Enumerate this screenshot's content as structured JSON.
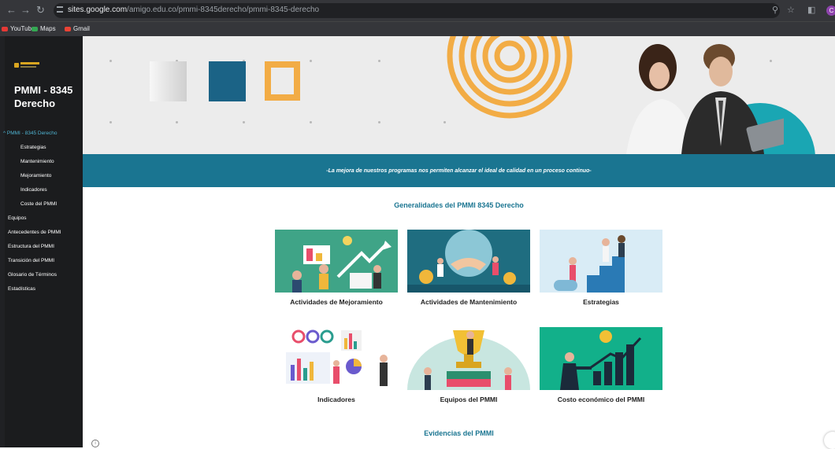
{
  "browser": {
    "url_host": "sites.google.com",
    "url_path": "/amigo.edu.co/pmmi-8345derecho/pmmi-8345-derecho",
    "bookmarks": [
      "YouTube",
      "Maps",
      "Gmail"
    ],
    "profile_initial": "C"
  },
  "sidebar": {
    "site_title": "PMMI - 8345 Derecho",
    "active_section": "PMMI - 8345 Derecho",
    "sub_items": [
      "Estrategias",
      "Mantenimiento",
      "Mejoramiento",
      "Indicadores",
      "Coste del PMMI"
    ],
    "top_items": [
      "Equipos",
      "Antecedentes de PMMI",
      "Estructura del PMMI",
      "Transición del PMMI",
      "Glosario de Términos",
      "Estadísticas"
    ]
  },
  "banner": {
    "tagline": "-La mejora de nuestros programas nos permiten alcanzar el ideal de calidad en un proceso continuo-"
  },
  "main": {
    "section_title": "Generalidades del PMMI 8345 Derecho",
    "cards": [
      {
        "label": "Actividades de Mejoramiento",
        "bg": "#3fa487"
      },
      {
        "label": "Actividades de Mantenimiento",
        "bg": "#1f6d80"
      },
      {
        "label": "Estrategias",
        "bg": "#d9ecf6"
      },
      {
        "label": "Indicadores",
        "bg": "#ffffff"
      },
      {
        "label": "Equipos del PMMI",
        "bg": "#e9f3f0"
      },
      {
        "label": "Costo económico del PMMI",
        "bg": "#12b08a"
      }
    ],
    "section2_title": "Evidencias del PMMI"
  },
  "colors": {
    "accent": "#1a7591",
    "sidebar_bg": "#1b1c1e",
    "active_link": "#4fb3d1"
  }
}
